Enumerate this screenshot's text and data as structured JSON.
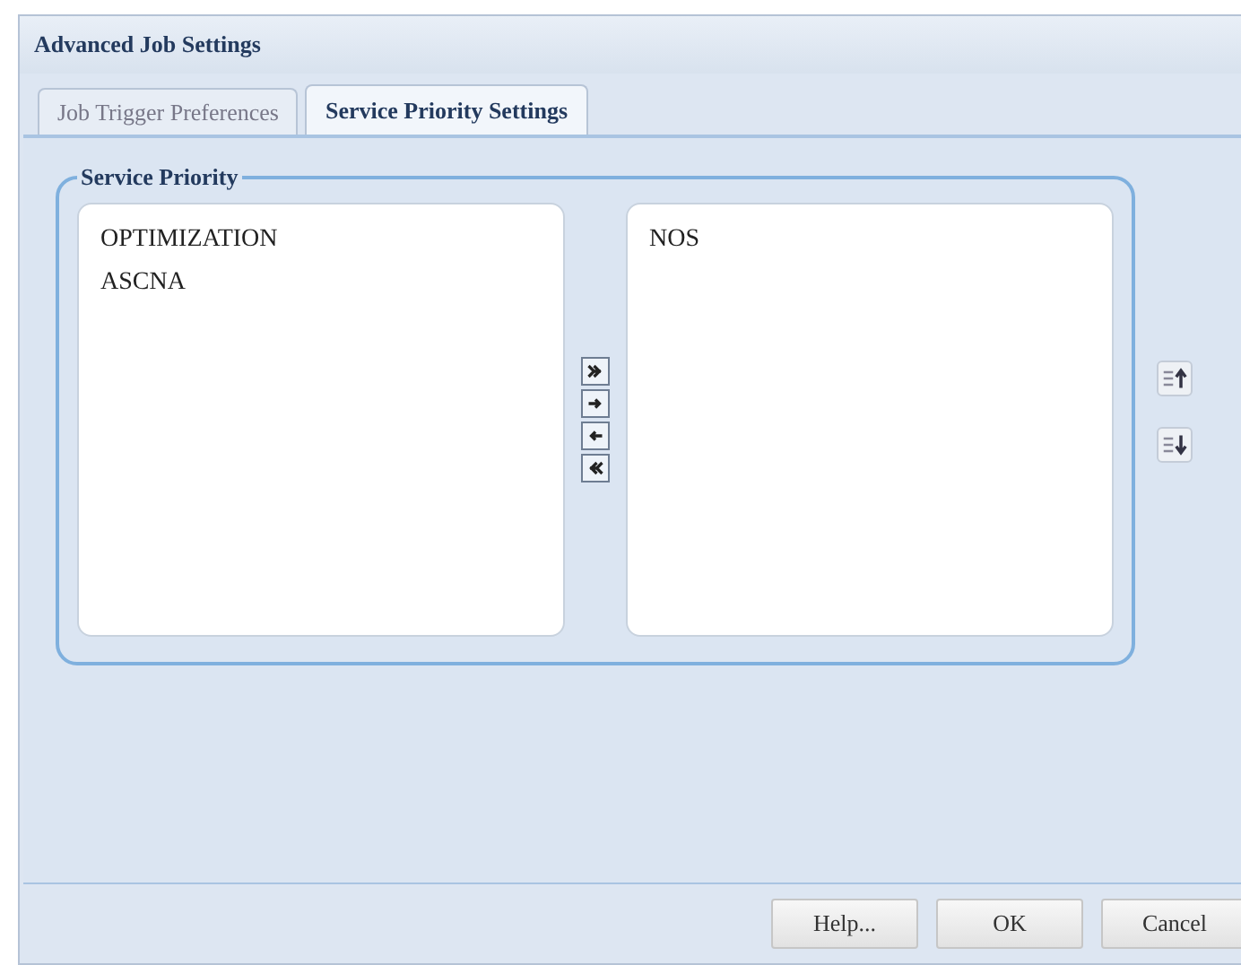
{
  "window": {
    "title": "Advanced Job Settings"
  },
  "tabs": [
    {
      "label": "Job Trigger Preferences",
      "selected": false
    },
    {
      "label": "Service Priority Settings",
      "selected": true
    }
  ],
  "group": {
    "legend": "Service Priority"
  },
  "available": {
    "items": [
      {
        "label": "OPTIMIZATION",
        "selected": false
      },
      {
        "label": "ASCNA",
        "selected": false
      }
    ]
  },
  "chosen": {
    "items": [
      {
        "label": "NOS",
        "selected": false
      }
    ]
  },
  "transfer_buttons": [
    {
      "kind": "add-all"
    },
    {
      "kind": "add"
    },
    {
      "kind": "remove"
    },
    {
      "kind": "remove-all"
    }
  ],
  "order_buttons": [
    {
      "kind": "up"
    },
    {
      "kind": "down"
    }
  ],
  "buttons": [
    "Help...",
    "OK",
    "Cancel"
  ]
}
